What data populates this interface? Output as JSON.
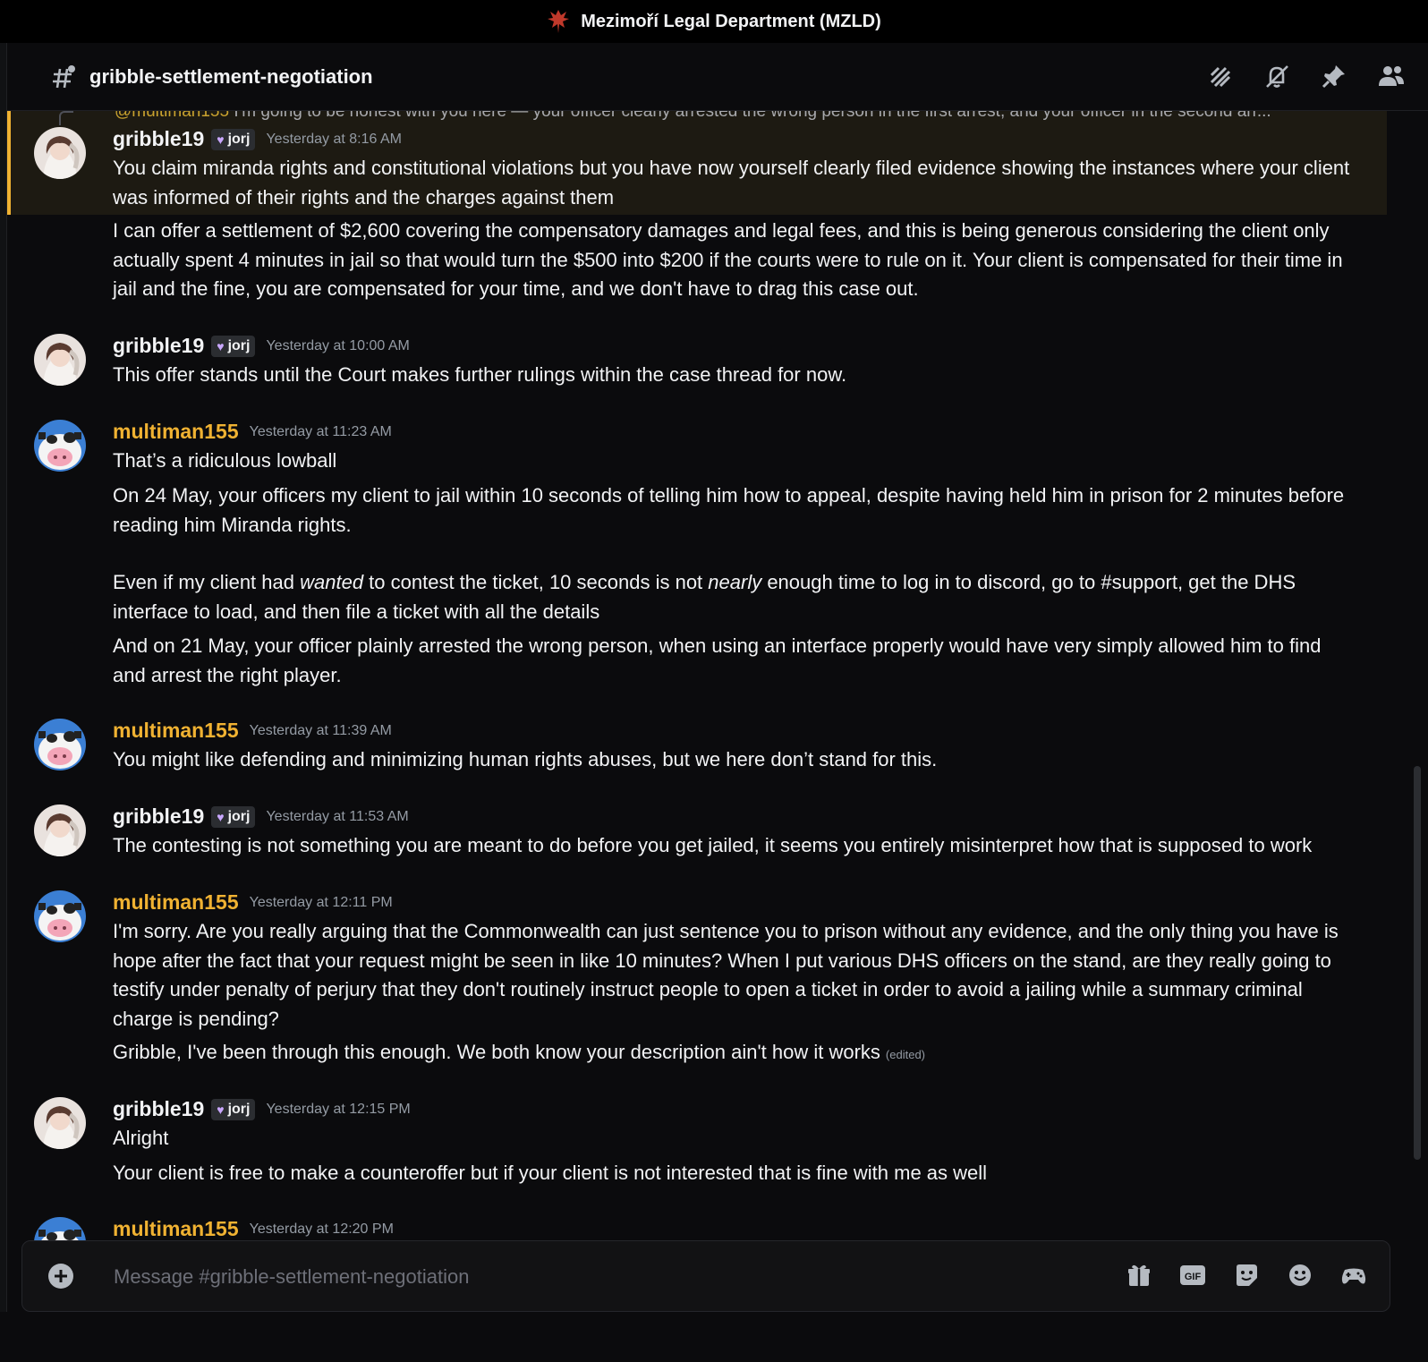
{
  "app": {
    "server_title": "Mezimoří Legal Department (MZLD)"
  },
  "channel": {
    "name": "gribble-settlement-negotiation"
  },
  "header_icons": [
    "threads-icon",
    "mute-icon",
    "pin-icon",
    "members-icon"
  ],
  "colors": {
    "accent": "#f0b232",
    "background": "#0b0b0d",
    "text": "#f2f3f5",
    "muted": "#949ba4"
  },
  "reply_peek": {
    "mention": "@multiman155",
    "text": " I'm going to be honest with you here — your officer clearly arrested the wrong person in the first arrest, and your officer in the second arr..."
  },
  "messages": [
    {
      "author": "gribble19",
      "tag": "jorj",
      "timestamp": "Yesterday at 8:16 AM",
      "lines": [
        "You claim miranda rights and constitutional violations but you have now yourself clearly filed evidence showing the instances where your client was informed of their rights and the charges against them",
        "I can offer a settlement of $2,600 covering the compensatory damages and legal fees, and this is being generous considering the client only actually spent 4 minutes in jail so that would turn the $500 into $200 if the courts were to rule on it. Your client is compensated for their time in jail and the fine, you are compensated for your time, and we don't have to drag this case out."
      ]
    },
    {
      "author": "gribble19",
      "tag": "jorj",
      "timestamp": "Yesterday at 10:00 AM",
      "lines": [
        "This offer stands until the Court makes further rulings within the case thread for now."
      ]
    },
    {
      "author": "multiman155",
      "timestamp": "Yesterday at 11:23 AM",
      "lines": [
        "That’s a ridiculous lowball",
        "On 24 May, your officers my client to jail within 10 seconds of telling him how to appeal, despite having held him in prison for 2 minutes before reading him Miranda rights.",
        "And on 21 May, your officer plainly arrested the wrong person, when using an interface properly would have very simply allowed him to find and arrest the right player."
      ],
      "rich_line": {
        "p1": "Even if my client had ",
        "em1": "wanted",
        "p2": " to contest the ticket, 10 seconds is not ",
        "em2": "nearly",
        "p3": " enough time to log in to discord, go to #support, get the DHS interface to load, and then file a ticket with all the details"
      }
    },
    {
      "author": "multiman155",
      "timestamp": "Yesterday at 11:39 AM",
      "lines": [
        "You might like defending and minimizing human rights abuses, but we here don’t stand for this."
      ]
    },
    {
      "author": "gribble19",
      "tag": "jorj",
      "timestamp": "Yesterday at 11:53 AM",
      "lines": [
        "The contesting is not something you are meant to do before you get jailed, it seems you entirely misinterpret how that is supposed to work"
      ]
    },
    {
      "author": "multiman155",
      "timestamp": "Yesterday at 12:11 PM",
      "lines": [
        "I'm sorry. Are you really arguing that the Commonwealth can just sentence you to prison without any evidence, and the only thing you have is hope after the fact that your request might be seen in like 10 minutes? When I put various DHS officers on the stand, are they really going to testify under penalty of perjury that they don't routinely instruct people to open a ticket in order to avoid a jailing while a summary criminal charge is pending?",
        "Gribble, I've been through this enough. We both know your description ain't how it works"
      ],
      "edited_label": "(edited)"
    },
    {
      "author": "gribble19",
      "tag": "jorj",
      "timestamp": "Yesterday at 12:15 PM",
      "lines": [
        "Alright",
        "Your client is free to make a counteroffer but if your client is not interested that is fine with me as well"
      ]
    },
    {
      "author": "multiman155",
      "timestamp": "Yesterday at 12:20 PM",
      "lines": []
    }
  ],
  "composer": {
    "placeholder": "Message #gribble-settlement-negotiation",
    "value": "",
    "gif_label": "GIF",
    "icons": [
      "add-icon",
      "gift-icon",
      "gif-icon",
      "sticker-icon",
      "emoji-icon",
      "activities-icon"
    ]
  }
}
